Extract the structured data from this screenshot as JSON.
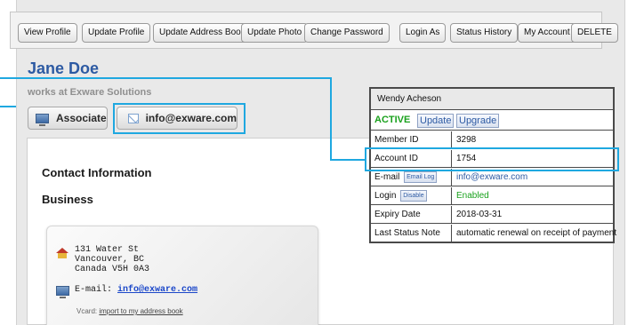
{
  "toolbar": {
    "buttons": [
      "View Profile",
      "Update Profile",
      "Update Address Book",
      "Update Photo",
      "Change Password",
      "Login As",
      "Status History",
      "My Account",
      "DELETE"
    ]
  },
  "profile": {
    "name": "Jane Doe",
    "works_at": "works at Exware Solutions",
    "associate_label": "Associate",
    "email_button_label": "info@exware.com"
  },
  "sections": {
    "contact": "Contact Information",
    "business": "Business"
  },
  "card": {
    "address_line1": "131 Water St",
    "address_line2": "Vancouver, BC",
    "address_line3": "Canada V5H 0A3",
    "email_prefix": "E-mail:",
    "email": "info@exware.com",
    "vcard_prefix": "Vcard:",
    "vcard_link": "import to my address book"
  },
  "status_panel": {
    "header": "Wendy Acheson",
    "status": "ACTIVE",
    "update_label": "Update",
    "upgrade_label": "Upgrade",
    "rows": [
      {
        "label": "Member ID",
        "value": "3298"
      },
      {
        "label": "Account ID",
        "value": "1754"
      },
      {
        "label": "E-mail",
        "button": "Email Log",
        "value": "info@exware.com"
      },
      {
        "label": "Login",
        "button": "Disable",
        "value": "Enabled"
      },
      {
        "label": "Expiry Date",
        "value": "2018-03-31"
      },
      {
        "label": "Last Status Note",
        "value": "automatic renewal on receipt of payment"
      }
    ]
  },
  "colors": {
    "name_blue": "#2d5aa3",
    "active_green": "#19a11c",
    "highlight": "#1fa8e0",
    "link_blue": "#1b47c9"
  }
}
